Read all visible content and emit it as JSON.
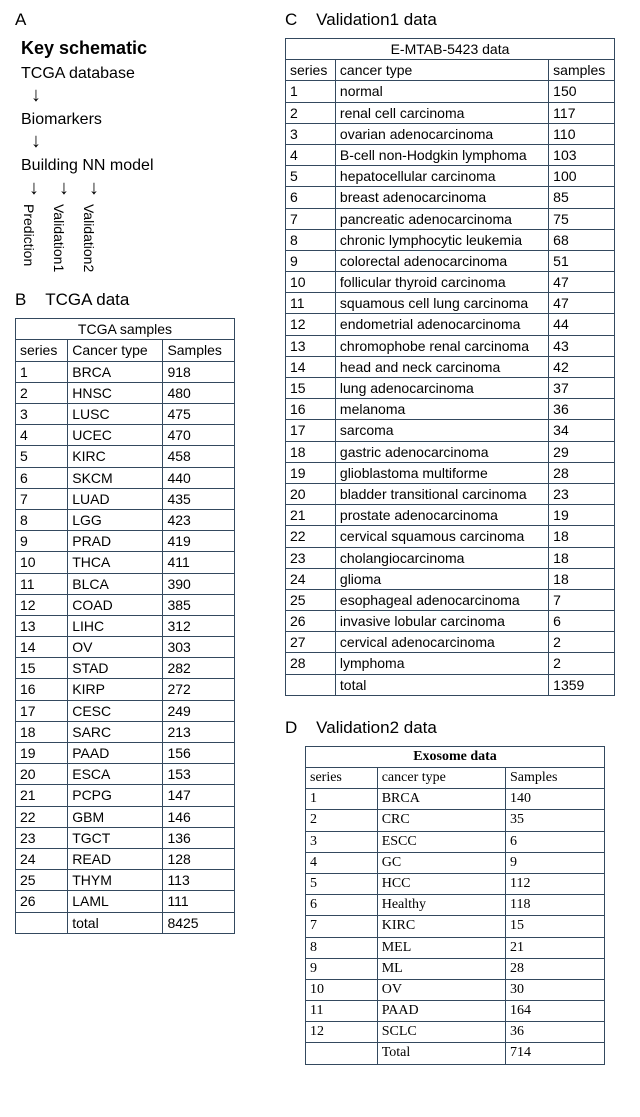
{
  "panelA": {
    "label": "A",
    "title": "Key schematic",
    "step1": "TCGA database",
    "step2": "Biomarkers",
    "step3": "Building NN model",
    "branch1": "Prediction",
    "branch2": "Validation1",
    "branch3": "Validation2"
  },
  "panelB": {
    "label": "B",
    "title": "TCGA data",
    "caption": "TCGA samples",
    "h_series": "series",
    "h_type": "Cancer type",
    "h_samples": "Samples",
    "rows": [
      {
        "series": "1",
        "type": "BRCA",
        "samples": "918"
      },
      {
        "series": "2",
        "type": "HNSC",
        "samples": "480"
      },
      {
        "series": "3",
        "type": "LUSC",
        "samples": "475"
      },
      {
        "series": "4",
        "type": "UCEC",
        "samples": "470"
      },
      {
        "series": "5",
        "type": "KIRC",
        "samples": "458"
      },
      {
        "series": "6",
        "type": "SKCM",
        "samples": "440"
      },
      {
        "series": "7",
        "type": "LUAD",
        "samples": "435"
      },
      {
        "series": "8",
        "type": "LGG",
        "samples": "423"
      },
      {
        "series": "9",
        "type": "PRAD",
        "samples": "419"
      },
      {
        "series": "10",
        "type": "THCA",
        "samples": "411"
      },
      {
        "series": "11",
        "type": "BLCA",
        "samples": "390"
      },
      {
        "series": "12",
        "type": "COAD",
        "samples": "385"
      },
      {
        "series": "13",
        "type": "LIHC",
        "samples": "312"
      },
      {
        "series": "14",
        "type": "OV",
        "samples": "303"
      },
      {
        "series": "15",
        "type": "STAD",
        "samples": "282"
      },
      {
        "series": "16",
        "type": "KIRP",
        "samples": "272"
      },
      {
        "series": "17",
        "type": "CESC",
        "samples": "249"
      },
      {
        "series": "18",
        "type": "SARC",
        "samples": "213"
      },
      {
        "series": "19",
        "type": "PAAD",
        "samples": "156"
      },
      {
        "series": "20",
        "type": "ESCA",
        "samples": "153"
      },
      {
        "series": "21",
        "type": "PCPG",
        "samples": "147"
      },
      {
        "series": "22",
        "type": "GBM",
        "samples": "146"
      },
      {
        "series": "23",
        "type": "TGCT",
        "samples": "136"
      },
      {
        "series": "24",
        "type": "READ",
        "samples": "128"
      },
      {
        "series": "25",
        "type": "THYM",
        "samples": "113"
      },
      {
        "series": "26",
        "type": "LAML",
        "samples": "111"
      }
    ],
    "total_label": "total",
    "total_value": "8425"
  },
  "panelC": {
    "label": "C",
    "title": "Validation1 data",
    "caption": "E-MTAB-5423 data",
    "h_series": "series",
    "h_type": "cancer type",
    "h_samples": "samples",
    "rows": [
      {
        "series": "1",
        "type": "normal",
        "samples": "150"
      },
      {
        "series": "2",
        "type": "renal cell carcinoma",
        "samples": "117"
      },
      {
        "series": "3",
        "type": "ovarian adenocarcinoma",
        "samples": "110"
      },
      {
        "series": "4",
        "type": "B-cell non-Hodgkin lymphoma",
        "samples": "103"
      },
      {
        "series": "5",
        "type": "hepatocellular carcinoma",
        "samples": "100"
      },
      {
        "series": "6",
        "type": "breast adenocarcinoma",
        "samples": "85"
      },
      {
        "series": "7",
        "type": "pancreatic adenocarcinoma",
        "samples": "75"
      },
      {
        "series": "8",
        "type": "chronic lymphocytic leukemia",
        "samples": "68"
      },
      {
        "series": "9",
        "type": "colorectal adenocarcinoma",
        "samples": "51"
      },
      {
        "series": "10",
        "type": "follicular thyroid carcinoma",
        "samples": "47"
      },
      {
        "series": "11",
        "type": "squamous cell lung carcinoma",
        "samples": "47"
      },
      {
        "series": "12",
        "type": "endometrial adenocarcinoma",
        "samples": "44"
      },
      {
        "series": "13",
        "type": "chromophobe renal carcinoma",
        "samples": "43"
      },
      {
        "series": "14",
        "type": "head and neck carcinoma",
        "samples": "42"
      },
      {
        "series": "15",
        "type": "lung adenocarcinoma",
        "samples": "37"
      },
      {
        "series": "16",
        "type": "melanoma",
        "samples": "36"
      },
      {
        "series": "17",
        "type": "sarcoma",
        "samples": "34"
      },
      {
        "series": "18",
        "type": "gastric adenocarcinoma",
        "samples": "29"
      },
      {
        "series": "19",
        "type": "glioblastoma multiforme",
        "samples": "28"
      },
      {
        "series": "20",
        "type": "bladder transitional carcinoma",
        "samples": "23"
      },
      {
        "series": "21",
        "type": "prostate adenocarcinoma",
        "samples": "19"
      },
      {
        "series": "22",
        "type": "cervical squamous carcinoma",
        "samples": "18"
      },
      {
        "series": "23",
        "type": "cholangiocarcinoma",
        "samples": "18"
      },
      {
        "series": "24",
        "type": "glioma",
        "samples": "18"
      },
      {
        "series": "25",
        "type": "esophageal adenocarcinoma",
        "samples": "7"
      },
      {
        "series": "26",
        "type": "invasive lobular carcinoma",
        "samples": "6"
      },
      {
        "series": "27",
        "type": "cervical adenocarcinoma",
        "samples": "2"
      },
      {
        "series": "28",
        "type": "lymphoma",
        "samples": "2"
      }
    ],
    "total_label": "total",
    "total_value": "1359"
  },
  "panelD": {
    "label": "D",
    "title": "Validation2 data",
    "caption": "Exosome data",
    "h_series": "series",
    "h_type": "cancer type",
    "h_samples": "Samples",
    "rows": [
      {
        "series": "1",
        "type": "BRCA",
        "samples": "140"
      },
      {
        "series": "2",
        "type": "CRC",
        "samples": "35"
      },
      {
        "series": "3",
        "type": "ESCC",
        "samples": "6"
      },
      {
        "series": "4",
        "type": "GC",
        "samples": "9"
      },
      {
        "series": "5",
        "type": "HCC",
        "samples": "112"
      },
      {
        "series": "6",
        "type": "Healthy",
        "samples": "118"
      },
      {
        "series": "7",
        "type": "KIRC",
        "samples": "15"
      },
      {
        "series": "8",
        "type": "MEL",
        "samples": "21"
      },
      {
        "series": "9",
        "type": "ML",
        "samples": "28"
      },
      {
        "series": "10",
        "type": "OV",
        "samples": "30"
      },
      {
        "series": "11",
        "type": "PAAD",
        "samples": "164"
      },
      {
        "series": "12",
        "type": "SCLC",
        "samples": "36"
      }
    ],
    "total_label": "Total",
    "total_value": "714"
  }
}
